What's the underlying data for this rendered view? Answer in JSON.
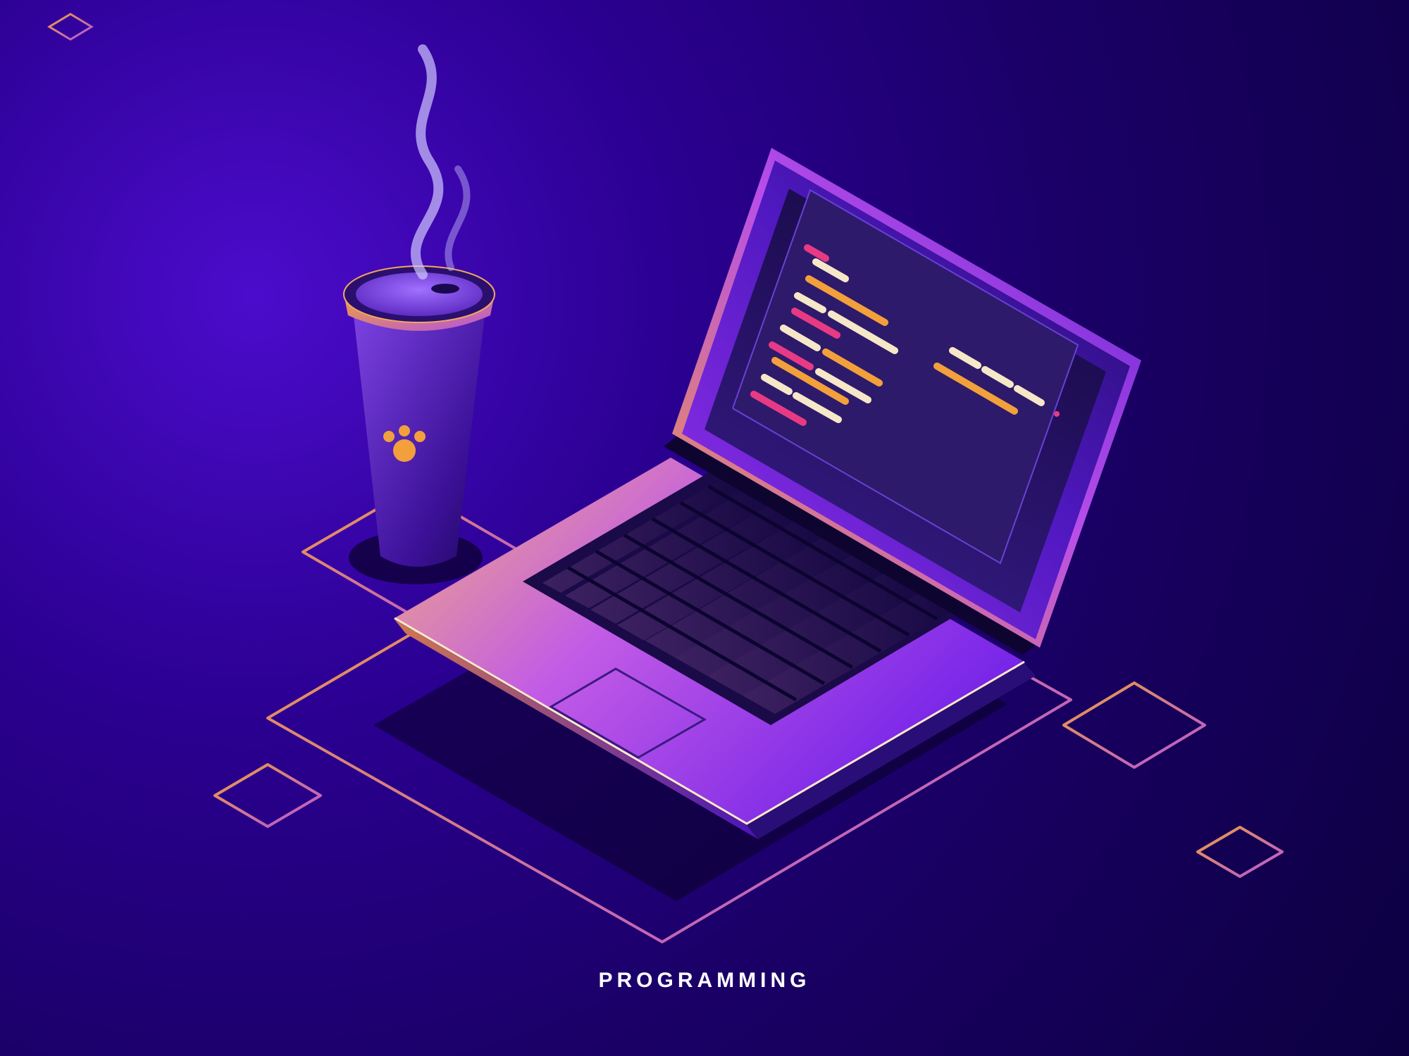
{
  "caption": "PROGRAMMING",
  "colors": {
    "bg_center": "#4c0ccc",
    "bg_edge": "#0c0040",
    "accent_orange": "#f2a03c",
    "accent_pink": "#e83a84",
    "accent_cream": "#f6e7c8",
    "laptop_front": "#e9a06a",
    "laptop_purple": "#8828f0",
    "screen_bg": "#23115a",
    "code_bg": "#2d1a6a",
    "cup_body": "#5f2cc4",
    "cup_dark": "#2a0f6e"
  },
  "icons": {
    "cup_badge": "paw-icon"
  }
}
